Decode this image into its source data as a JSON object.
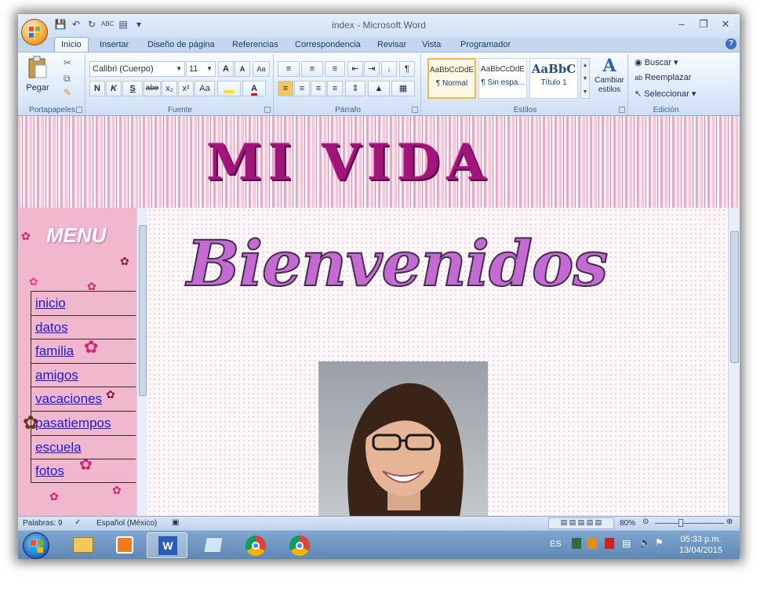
{
  "window": {
    "title": "index - Microsoft Word"
  },
  "tabs": [
    "Inicio",
    "Insertar",
    "Diseño de página",
    "Referencias",
    "Correspondencia",
    "Revisar",
    "Vista",
    "Programador"
  ],
  "ribbon": {
    "clipboard": {
      "paste_label": "Pegar",
      "group_label": "Portapapeles"
    },
    "font": {
      "name": "Calibri (Cuerpo)",
      "size": "11",
      "group_label": "Fuente",
      "bold": "N",
      "italic": "K",
      "underline": "S",
      "strike": "abe",
      "sub": "x₂",
      "sup": "x²",
      "case": "Aa"
    },
    "paragraph": {
      "group_label": "Párrafo"
    },
    "styles": {
      "items": [
        {
          "sample": "AaBbCcDdE",
          "name": "¶ Normal"
        },
        {
          "sample": "AaBbCcDdE",
          "name": "¶ Sin espa..."
        },
        {
          "sample": "AaBbC",
          "name": "Título 1"
        }
      ],
      "change_label": "Cambiar estilos",
      "group_label": "Estilos"
    },
    "editing": {
      "find": "Buscar",
      "replace": "Reemplazar",
      "select": "Seleccionar",
      "group_label": "Edición"
    }
  },
  "document": {
    "banner_title": "MI VIDA",
    "menu_title": "MENU",
    "menu_items": [
      "inicio",
      "datos",
      "familia",
      "amigos",
      "vacaciones",
      "pasatiempos",
      "escuela",
      "fotos"
    ],
    "welcome": "Bienvenidos"
  },
  "status": {
    "words": "Palabras: 9",
    "language": "Español (México)",
    "zoom": "80%"
  },
  "taskbar": {
    "lang": "ES",
    "time": "05:33 p.m.",
    "date": "13/04/2015"
  }
}
